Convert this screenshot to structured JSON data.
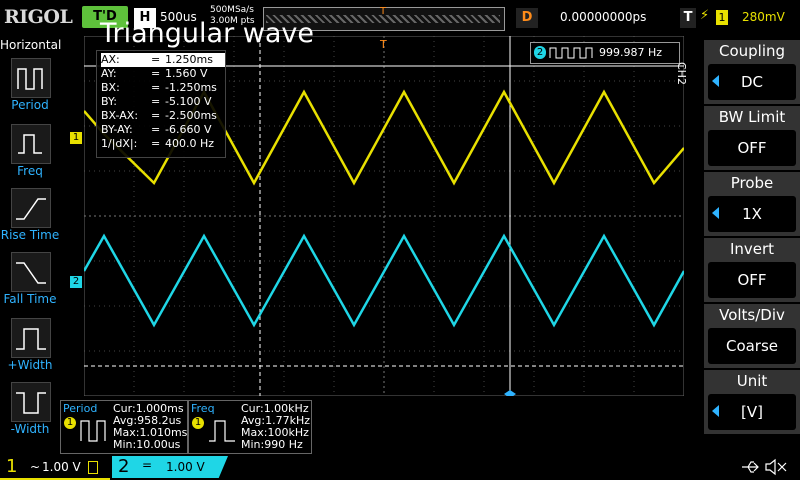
{
  "topbar": {
    "logo": "RIGOL",
    "trigger_status": "T'D",
    "horizontal_label": "H",
    "timebase": "500us",
    "sample_rate": "500MSa/s",
    "memory_depth": "3.00M pts",
    "trigger_marker": "T",
    "delay_label": "D",
    "delay_value": "0.00000000ps",
    "trigger_label": "T",
    "trigger_slope": "⚡",
    "trigger_channel": "1",
    "trigger_level": "280mV"
  },
  "title": "Triangular wave",
  "left_panel": {
    "title": "Horizontal",
    "items": [
      {
        "label": "Period"
      },
      {
        "label": "Freq"
      },
      {
        "label": "Rise Time"
      },
      {
        "label": "Fall Time"
      },
      {
        "label": "+Width"
      },
      {
        "label": "-Width"
      }
    ]
  },
  "cursor_readout": [
    {
      "key": "AX:",
      "value": "1.250ms"
    },
    {
      "key": "AY:",
      "value": "1.560 V"
    },
    {
      "key": "BX:",
      "value": "-1.250ms"
    },
    {
      "key": "BY:",
      "value": "-5.100 V"
    },
    {
      "key": "BX-AX:",
      "value": "-2.500ms"
    },
    {
      "key": "BY-AY:",
      "value": "-6.660 V"
    },
    {
      "key": "1/|dX|:",
      "value": "400.0 Hz"
    }
  ],
  "freq_counter": {
    "channel": "2",
    "value": "999.987 Hz"
  },
  "channel_markers": {
    "ch1": "1",
    "ch2": "2"
  },
  "right_menu": {
    "channel": "CH2",
    "items": [
      {
        "title": "Coupling",
        "value": "DC",
        "has_arrow": true
      },
      {
        "title": "BW Limit",
        "value": "OFF",
        "has_arrow": false
      },
      {
        "title": "Probe",
        "value": "1X",
        "has_arrow": true
      },
      {
        "title": "Invert",
        "value": "OFF",
        "has_arrow": false
      },
      {
        "title": "Volts/Div",
        "value": "Coarse",
        "has_arrow": false
      },
      {
        "title": "Unit",
        "value": "[V]",
        "has_arrow": true
      }
    ]
  },
  "measurements": [
    {
      "title": "Period",
      "channel": "1",
      "lines": [
        "Cur:1.000ms",
        "Avg:958.2us",
        "Max:1.010ms",
        "Min:10.00us"
      ]
    },
    {
      "title": "Freq",
      "channel": "1",
      "lines": [
        "Cur:1.00kHz",
        "Avg:1.77kHz",
        "Max:100kHz",
        "Min:990 Hz"
      ]
    }
  ],
  "bottombar": {
    "ch1_num": "1",
    "ch1_coupling": "~",
    "ch1_scale": "1.00 V",
    "ch2_num": "2",
    "ch2_coupling": "=",
    "ch2_scale": "1.00 V"
  },
  "colors": {
    "ch1": "#e8e000",
    "ch2": "#1fd6e6",
    "accent": "#2fb3ff",
    "trigger": "#ff8c1a",
    "status": "#5ec13b"
  }
}
